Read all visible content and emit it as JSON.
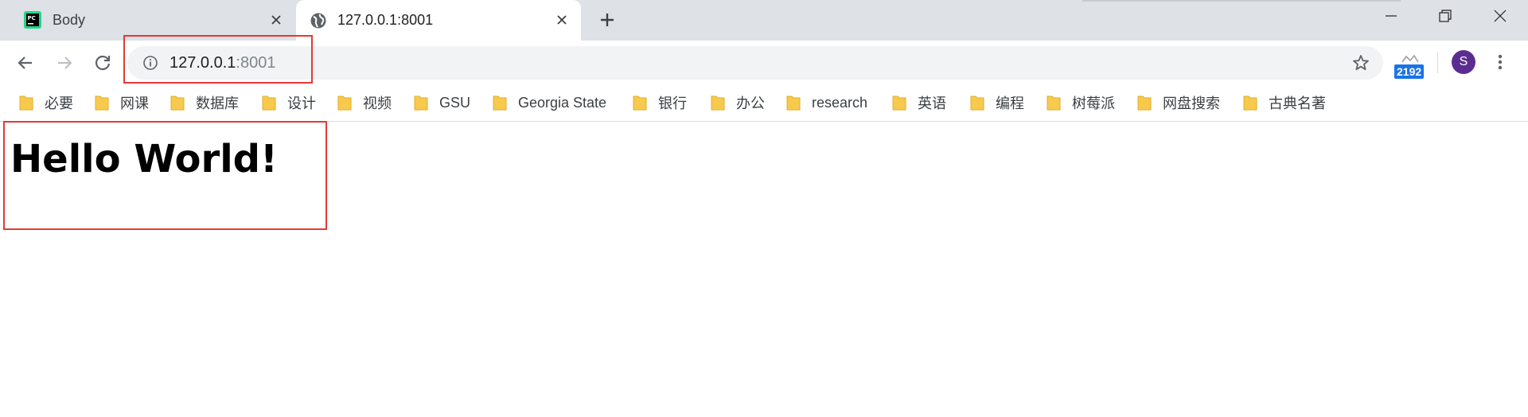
{
  "tabs": [
    {
      "title": "Body",
      "favicon": "pycharm-icon",
      "active": false
    },
    {
      "title": "127.0.0.1:8001",
      "favicon": "globe-icon",
      "active": true
    }
  ],
  "address_bar": {
    "host": "127.0.0.1",
    "port": ":8001"
  },
  "extension": {
    "badge": "2192"
  },
  "profile": {
    "initial": "S"
  },
  "bookmarks": [
    "必要",
    "网课",
    "数据库",
    "设计",
    "视频",
    "GSU",
    "Georgia State",
    "银行",
    "办公",
    "research",
    "英语",
    "编程",
    "树莓派",
    "网盘搜索",
    "古典名著"
  ],
  "page": {
    "heading": "Hello World!"
  },
  "colors": {
    "highlight": "#e53935",
    "folder": "#f7ca4d",
    "avatar": "#5c2d91",
    "badge": "#1a73e8"
  }
}
